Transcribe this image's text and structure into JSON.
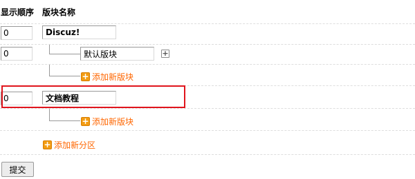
{
  "table": {
    "headers": {
      "order": "显示顺序",
      "name": "版块名称"
    }
  },
  "rows": {
    "discuz": {
      "order": "0",
      "name": "Discuz!"
    },
    "default_forum": {
      "order": "0",
      "name": "默认版块"
    },
    "add_forum_1": {
      "label": "添加新版块"
    },
    "doc_tutorial": {
      "order": "0",
      "name": "文档教程"
    },
    "add_forum_2": {
      "label": "添加新版块"
    },
    "add_category": {
      "label": "添加新分区"
    }
  },
  "icons": {
    "add_sub": "plus-square-gray",
    "add": "plus-square-orange"
  },
  "colors": {
    "link": "#ff6600",
    "highlight": "#e0141c",
    "divider": "#dddddd"
  },
  "submit_label": "提交"
}
